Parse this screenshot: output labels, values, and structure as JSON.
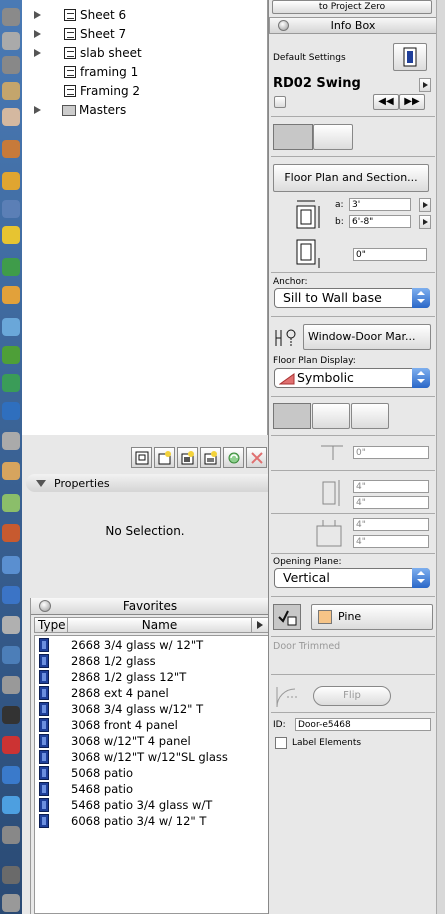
{
  "navigator": {
    "items": [
      {
        "label": "Sheet 6",
        "icon": "sheet-icon",
        "expandable": true
      },
      {
        "label": "Sheet 7",
        "icon": "sheet-icon",
        "expandable": true
      },
      {
        "label": "slab sheet",
        "icon": "sheet-icon",
        "expandable": true
      },
      {
        "label": "framing 1",
        "icon": "sheet-icon",
        "expandable": false
      },
      {
        "label": "Framing 2",
        "icon": "sheet-icon",
        "expandable": false
      },
      {
        "label": "Masters",
        "icon": "folder-icon",
        "expandable": true
      }
    ]
  },
  "properties": {
    "title": "Properties",
    "empty_text": "No Selection."
  },
  "favorites": {
    "title": "Favorites",
    "columns": {
      "type": "Type",
      "name": "Name"
    },
    "items": [
      "2668 3/4 glass w/ 12\"T",
      "2868 1/2 glass",
      "2868 1/2 glass 12\"T",
      "2868 ext 4 panel",
      "3068 3/4 glass w/12\" T",
      "3068 front 4 panel",
      "3068 w/12\"T 4 panel",
      "3068 w/12\"T w/12\"SL glass",
      "5068 patio",
      "5468 patio",
      "5468 patio 3/4 glass w/T",
      "6068 patio 3/4 w/ 12\" T"
    ]
  },
  "infobox": {
    "top_text": "to Project Zero",
    "title": "Info Box",
    "default_settings": "Default Settings",
    "object_name": "RD02 Swing",
    "floor_plan_section_btn": "Floor Plan and Section...",
    "dim_a_label": "a:",
    "dim_a_value": "3'",
    "dim_b_label": "b:",
    "dim_b_value": "6'-8\"",
    "elev_value": "0\"",
    "anchor_label": "Anchor:",
    "anchor_value": "Sill to Wall base",
    "marker_value": "Window-Door Mar...",
    "floor_plan_display_label": "Floor Plan Display:",
    "floor_plan_display_value": "Symbolic",
    "reveal_value": "0\"",
    "reveal2_a": "4\"",
    "reveal2_b": "4\"",
    "reveal3_a": "4\"",
    "reveal3_b": "4\"",
    "opening_plane_label": "Opening Plane:",
    "opening_plane_value": "Vertical",
    "material_value": "Pine",
    "material_color": "#f6c487",
    "door_trimmed": "Door Trimmed",
    "flip_btn": "Flip",
    "id_label": "ID:",
    "id_value": "Door-e5468",
    "label_elements": "Label Elements"
  },
  "colors": {
    "dock_top": "#4a7ab5",
    "door_icon": "#1f3f9a",
    "popup_blue": "#2a67c8"
  }
}
